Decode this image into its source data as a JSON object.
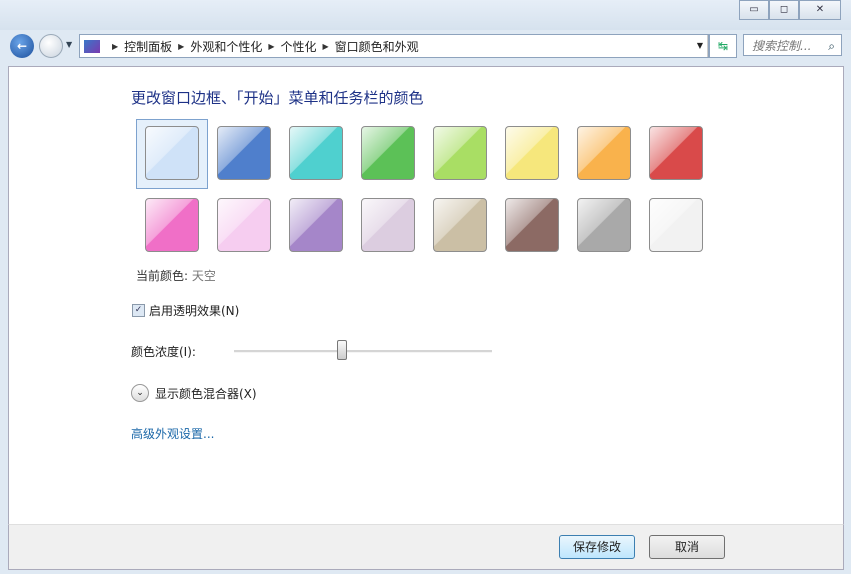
{
  "window": {
    "minimize": "▭",
    "maximize": "◻",
    "close": "✕"
  },
  "nav": {
    "back": "←",
    "breadcrumb": [
      "控制面板",
      "外观和个性化",
      "个性化",
      "窗口颜色和外观"
    ],
    "search_placeholder": "搜索控制...",
    "search_icon": "⌕",
    "refresh": "↹"
  },
  "main": {
    "title": "更改窗口边框、「开始」菜单和任务栏的颜色",
    "swatches": [
      {
        "name": "sky",
        "color": "#cfe2f8"
      },
      {
        "name": "twilight",
        "color": "#4f7fcc"
      },
      {
        "name": "sea",
        "color": "#4fd0cf"
      },
      {
        "name": "leaf",
        "color": "#5cc157"
      },
      {
        "name": "lime",
        "color": "#a9de64"
      },
      {
        "name": "sun",
        "color": "#f6e77c"
      },
      {
        "name": "pumpkin",
        "color": "#f9b24c"
      },
      {
        "name": "ruby",
        "color": "#d94a4a"
      },
      {
        "name": "fuchsia",
        "color": "#f06fc7"
      },
      {
        "name": "blush",
        "color": "#f6cdf0"
      },
      {
        "name": "violet",
        "color": "#a586c9"
      },
      {
        "name": "lavender",
        "color": "#dccde0"
      },
      {
        "name": "taupe",
        "color": "#cbbfa5"
      },
      {
        "name": "chocolate",
        "color": "#8c6a64"
      },
      {
        "name": "slate",
        "color": "#a9a9a9"
      },
      {
        "name": "frost",
        "color": "#f2f2f2"
      }
    ],
    "selected_index": 0,
    "current_label": "当前颜色:",
    "current_value": "天空",
    "transparency_label": "启用透明效果(N)",
    "transparency_checked": true,
    "intensity_label": "颜色浓度(I):",
    "intensity_percent": 42,
    "mixer_label": "显示颜色混合器(X)",
    "advanced_link": "高级外观设置..."
  },
  "footer": {
    "save": "保存修改",
    "cancel": "取消"
  }
}
